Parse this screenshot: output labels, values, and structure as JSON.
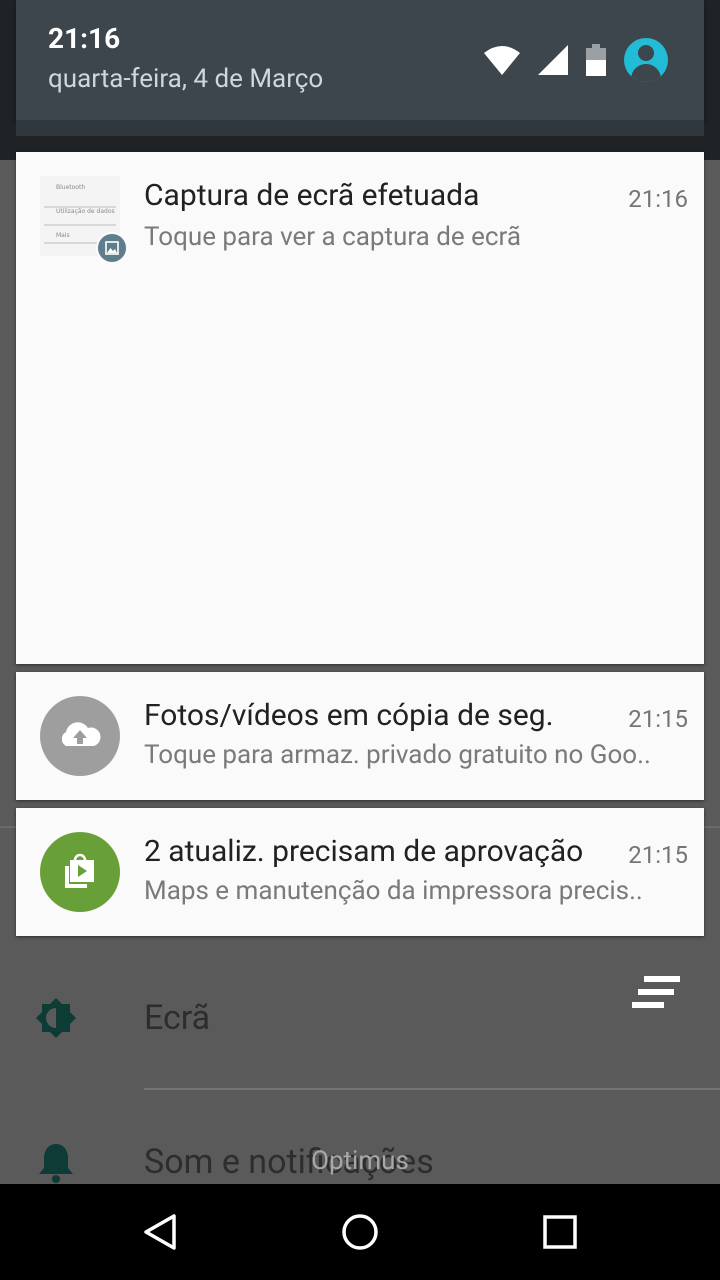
{
  "status": {
    "time": "21:16",
    "date": "quarta-feira, 4 de Março",
    "icons": [
      "wifi-icon",
      "cell-signal-icon",
      "battery-icon",
      "account-icon"
    ]
  },
  "notifications": [
    {
      "title": "Captura de ecrã efetuada",
      "time": "21:16",
      "text": "Toque para ver a captura de ecrã",
      "icon": "screenshot-thumbnail",
      "thumb_lines": [
        "Bluetooth",
        "Utilização de dados",
        "Mais"
      ]
    },
    {
      "title": "Fotos/vídeos em cópia de seg.",
      "time": "21:15",
      "text": "Toque para armaz. privado gratuito no Goo..",
      "icon": "cloud-upload-icon",
      "icon_color": "#9e9e9e"
    },
    {
      "title": "2 atualiz. precisam de aprovação",
      "time": "21:15",
      "text": "Maps e manutenção da impressora precis..",
      "icon": "play-store-icon",
      "icon_color": "#689f38"
    }
  ],
  "background": {
    "items": [
      {
        "label": "Ecrã",
        "icon": "brightness-icon"
      },
      {
        "label": "Som e notificações",
        "icon": "bell-icon"
      }
    ]
  },
  "watermark": "Optimus",
  "navbar": [
    "back-icon",
    "home-icon",
    "recents-icon"
  ]
}
